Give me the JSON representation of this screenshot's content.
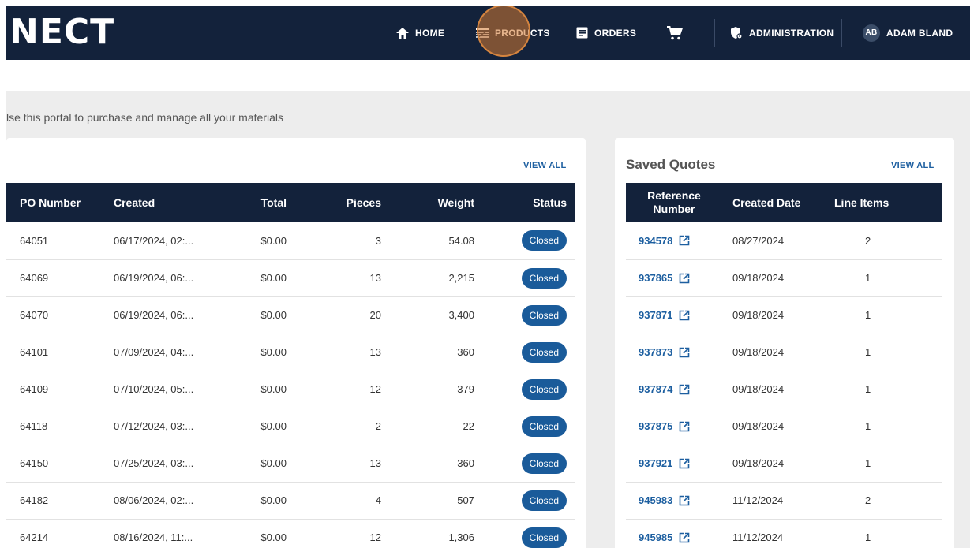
{
  "nav": {
    "logo": "NECT",
    "home": "HOME",
    "products": "PRODUCTS",
    "orders": "ORDERS",
    "administration": "ADMINISTRATION",
    "user_initials": "AB",
    "user_name": "ADAM BLAND"
  },
  "intro_text": "lse this portal to purchase and manage all your materials",
  "orders": {
    "view_all": "VIEW ALL",
    "columns": [
      "PO Number",
      "Created",
      "Total",
      "Pieces",
      "Weight",
      "Status"
    ],
    "rows": [
      [
        "64051",
        "06/17/2024, 02:...",
        "$0.00",
        "3",
        "54.08",
        "Closed"
      ],
      [
        "64069",
        "06/19/2024, 06:...",
        "$0.00",
        "13",
        "2,215",
        "Closed"
      ],
      [
        "64070",
        "06/19/2024, 06:...",
        "$0.00",
        "20",
        "3,400",
        "Closed"
      ],
      [
        "64101",
        "07/09/2024, 04:...",
        "$0.00",
        "13",
        "360",
        "Closed"
      ],
      [
        "64109",
        "07/10/2024, 05:...",
        "$0.00",
        "12",
        "379",
        "Closed"
      ],
      [
        "64118",
        "07/12/2024, 03:...",
        "$0.00",
        "2",
        "22",
        "Closed"
      ],
      [
        "64150",
        "07/25/2024, 03:...",
        "$0.00",
        "13",
        "360",
        "Closed"
      ],
      [
        "64182",
        "08/06/2024, 02:...",
        "$0.00",
        "4",
        "507",
        "Closed"
      ],
      [
        "64214",
        "08/16/2024, 11:...",
        "$0.00",
        "12",
        "1,306",
        "Closed"
      ]
    ]
  },
  "quotes": {
    "title": "Saved Quotes",
    "view_all": "VIEW ALL",
    "columns": [
      "Reference Number",
      "Created Date",
      "Line Items"
    ],
    "rows": [
      [
        "934578",
        "08/27/2024",
        "2"
      ],
      [
        "937865",
        "09/18/2024",
        "1"
      ],
      [
        "937871",
        "09/18/2024",
        "1"
      ],
      [
        "937873",
        "09/18/2024",
        "1"
      ],
      [
        "937874",
        "09/18/2024",
        "1"
      ],
      [
        "937875",
        "09/18/2024",
        "1"
      ],
      [
        "937921",
        "09/18/2024",
        "1"
      ],
      [
        "945983",
        "11/12/2024",
        "2"
      ],
      [
        "945985",
        "11/12/2024",
        "1"
      ]
    ]
  },
  "colors": {
    "navbar": "#13223b",
    "accent": "#1d5fa0",
    "badge": "#1a5b9a",
    "click_highlight": "#d67a32"
  }
}
